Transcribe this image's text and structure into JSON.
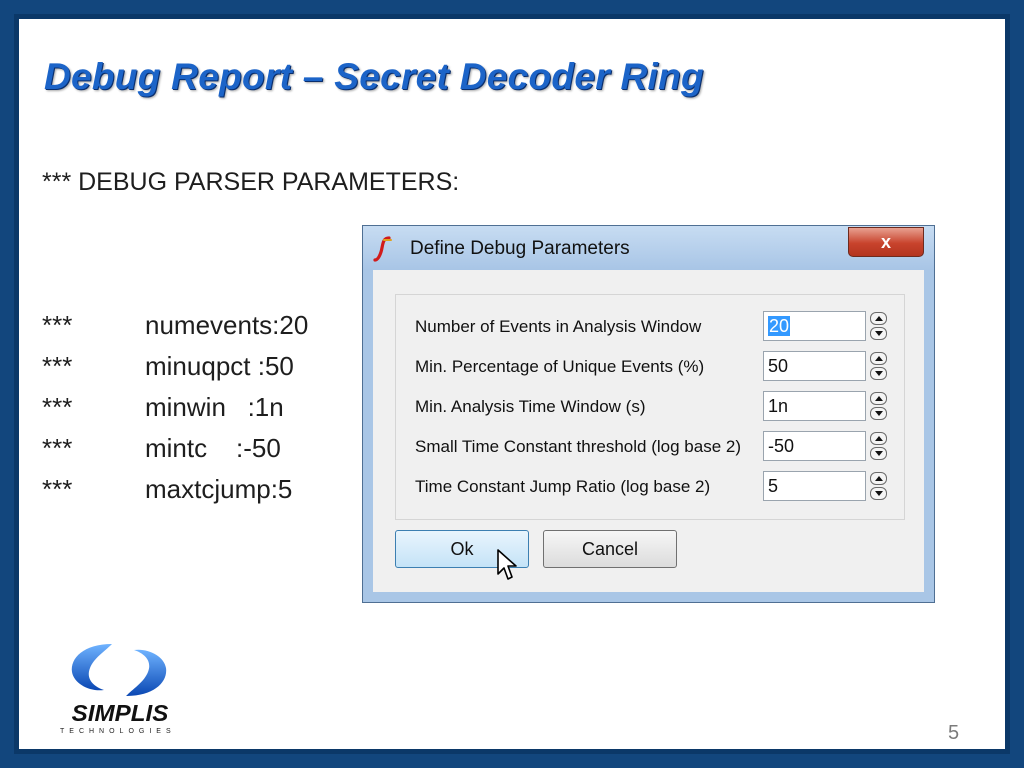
{
  "slide": {
    "title": "Debug Report – Secret Decoder Ring",
    "heading": "*** DEBUG PARSER PARAMETERS:",
    "params": [
      {
        "stars": "***",
        "text": "numevents:20"
      },
      {
        "stars": "***",
        "text": "minuqpct :50"
      },
      {
        "stars": "***",
        "text": "minwin   :1n"
      },
      {
        "stars": "***",
        "text": "mintc    :-50"
      },
      {
        "stars": "***",
        "text": "maxtcjump:5"
      }
    ],
    "page_number": "5"
  },
  "dialog": {
    "title": "Define Debug Parameters",
    "close_label": "x",
    "fields": [
      {
        "label": "Number of Events in Analysis Window",
        "value": "20"
      },
      {
        "label": "Min. Percentage of Unique Events (%)",
        "value": "50"
      },
      {
        "label": "Min. Analysis Time Window (s)",
        "value": "1n"
      },
      {
        "label": "Small Time Constant threshold (log base 2)",
        "value": "-50"
      },
      {
        "label": "Time Constant Jump Ratio (log base 2)",
        "value": "5"
      }
    ],
    "ok_label": "Ok",
    "cancel_label": "Cancel"
  },
  "logo": {
    "word": "SIMPLIS",
    "sub": "TECHNOLOGIES"
  },
  "colors": {
    "title": "#1c64c8",
    "frame": "#12467d",
    "dialog_frame": "#a9c6e6",
    "selection": "#3399ff",
    "logo_blue": "#1f6fd1"
  },
  "icons": [
    "simplis-app-icon",
    "close-icon",
    "spin-up-icon",
    "spin-down-icon",
    "mouse-pointer-icon",
    "simplis-logo-icon"
  ]
}
